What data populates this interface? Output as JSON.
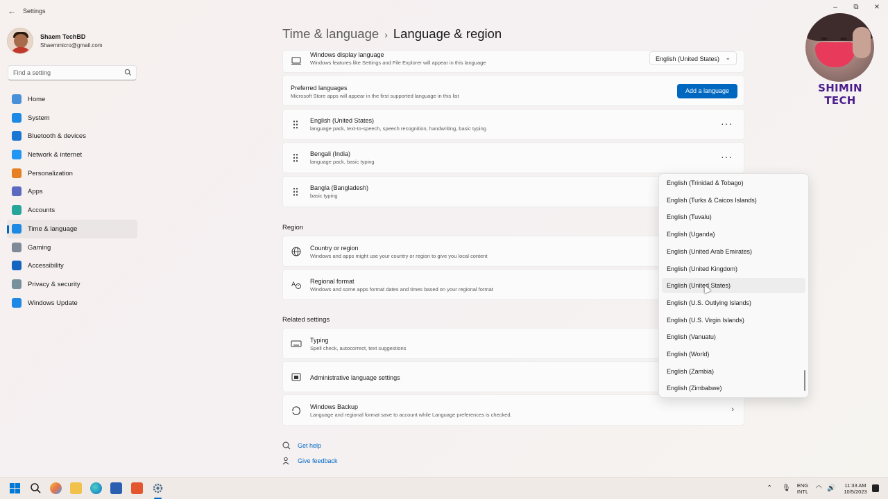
{
  "app": {
    "title": "Settings",
    "back_glyph": "←",
    "minimize_glyph": "–",
    "maximize_glyph": "⧉",
    "close_glyph": "✕"
  },
  "profile": {
    "name": "Shaem TechBD",
    "email": "Shaemmicro@gmail.com"
  },
  "search": {
    "placeholder": "Find a setting"
  },
  "nav": {
    "items": [
      {
        "label": "Home",
        "icon": "home-icon",
        "color": "#4a90d9"
      },
      {
        "label": "System",
        "icon": "system-icon",
        "color": "#1e88e5"
      },
      {
        "label": "Bluetooth & devices",
        "icon": "bluetooth-icon",
        "color": "#1976d2"
      },
      {
        "label": "Network & internet",
        "icon": "wifi-icon",
        "color": "#2196f3"
      },
      {
        "label": "Personalization",
        "icon": "brush-icon",
        "color": "#e67e22"
      },
      {
        "label": "Apps",
        "icon": "apps-icon",
        "color": "#5c6bc0"
      },
      {
        "label": "Accounts",
        "icon": "accounts-icon",
        "color": "#26a69a"
      },
      {
        "label": "Time & language",
        "icon": "globe-clock-icon",
        "color": "#1e88e5"
      },
      {
        "label": "Gaming",
        "icon": "gaming-icon",
        "color": "#7e8a97"
      },
      {
        "label": "Accessibility",
        "icon": "accessibility-icon",
        "color": "#1565c0"
      },
      {
        "label": "Privacy & security",
        "icon": "shield-icon",
        "color": "#78909c"
      },
      {
        "label": "Windows Update",
        "icon": "update-icon",
        "color": "#1e88e5"
      }
    ],
    "active_index": 7
  },
  "breadcrumb": {
    "parent": "Time & language",
    "separator": "›",
    "current": "Language & region"
  },
  "languages": {
    "display": {
      "title": "Windows display language",
      "subtitle": "Windows features like Settings and File Explorer will appear in this language",
      "value": "English (United States)"
    },
    "preferred": {
      "title": "Preferred languages",
      "subtitle": "Microsoft Store apps will appear in the first supported language in this list",
      "button": "Add a language"
    },
    "list": [
      {
        "name": "English (United States)",
        "detail": "language pack, text-to-speech, speech recognition, handwriting, basic typing"
      },
      {
        "name": "Bengali (India)",
        "detail": "language pack, basic typing"
      },
      {
        "name": "Bangla (Bangladesh)",
        "detail": "basic typing"
      }
    ]
  },
  "region": {
    "header": "Region",
    "country": {
      "title": "Country or region",
      "subtitle": "Windows and apps might use your country or region to give you local content"
    },
    "format": {
      "title": "Regional format",
      "subtitle": "Windows and some apps format dates and times based on your regional format"
    }
  },
  "related": {
    "header": "Related settings",
    "typing": {
      "title": "Typing",
      "subtitle": "Spell check, autocorrect, text suggestions"
    },
    "admin": {
      "title": "Administrative language settings"
    },
    "backup": {
      "title": "Windows Backup",
      "subtitle": "Language and regional format save to account while Language preferences is checked."
    }
  },
  "help": {
    "get_help": "Get help",
    "feedback": "Give feedback"
  },
  "dropdown": {
    "items": [
      "English (Trinidad & Tobago)",
      "English (Turks & Caicos Islands)",
      "English (Tuvalu)",
      "English (Uganda)",
      "English (United Arab Emirates)",
      "English (United Kingdom)",
      "English (United States)",
      "English (U.S. Outlying Islands)",
      "English (U.S. Virgin Islands)",
      "English (Vanuatu)",
      "English (World)",
      "English (Zambia)",
      "English (Zimbabwe)"
    ],
    "hover_index": 6
  },
  "overlay": {
    "brand": "SHIMIN TECH"
  },
  "taskbar": {
    "lang_top": "ENG",
    "lang_bottom": "INTL",
    "time": "11:33 AM",
    "date": "10/5/2023"
  }
}
